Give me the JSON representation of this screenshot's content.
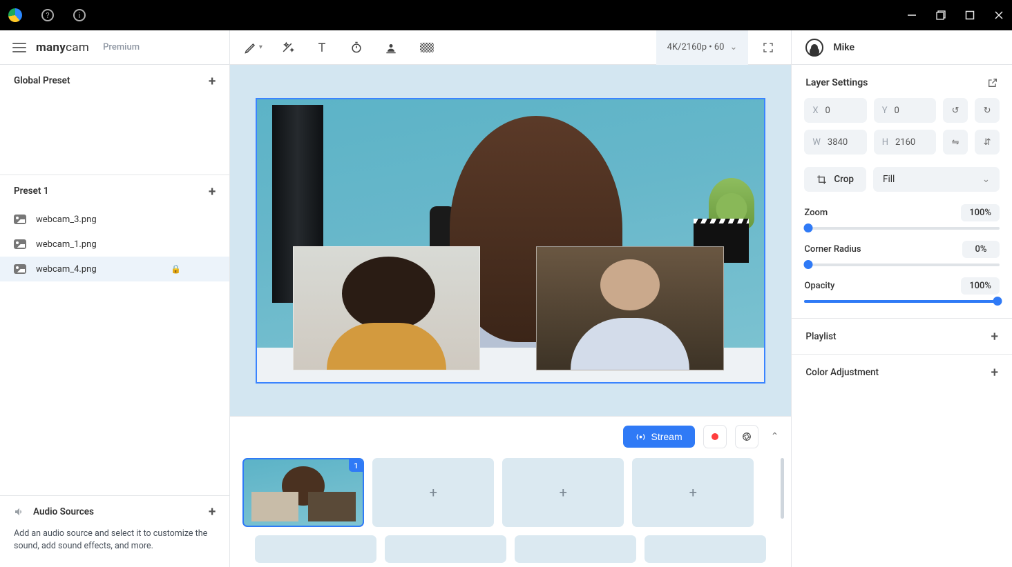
{
  "titlebar": {
    "help": "?",
    "info": "i"
  },
  "brand": {
    "name": "many",
    "name2": "cam",
    "plan": "Premium"
  },
  "sidebar": {
    "global": "Global Preset",
    "preset_name": "Preset 1",
    "items": [
      {
        "label": "webcam_3.png"
      },
      {
        "label": "webcam_1.png"
      },
      {
        "label": "webcam_4.png"
      }
    ],
    "audio_title": "Audio Sources",
    "audio_hint": "Add an audio source and select it to customize the sound, add sound effects, and more."
  },
  "topbar": {
    "resolution": "4K/2160p • 60"
  },
  "bottom": {
    "stream": "Stream",
    "slot_badge": "1"
  },
  "user": {
    "name": "Mike"
  },
  "layer": {
    "title": "Layer Settings",
    "x_label": "X",
    "x": "0",
    "y_label": "Y",
    "y": "0",
    "w_label": "W",
    "w": "3840",
    "h_label": "H",
    "h": "2160",
    "crop": "Crop",
    "fill": "Fill",
    "zoom_label": "Zoom",
    "zoom_val": "100%",
    "corner_label": "Corner Radius",
    "corner_val": "0%",
    "opacity_label": "Opacity",
    "opacity_val": "100%",
    "playlist": "Playlist",
    "color": "Color Adjustment"
  }
}
